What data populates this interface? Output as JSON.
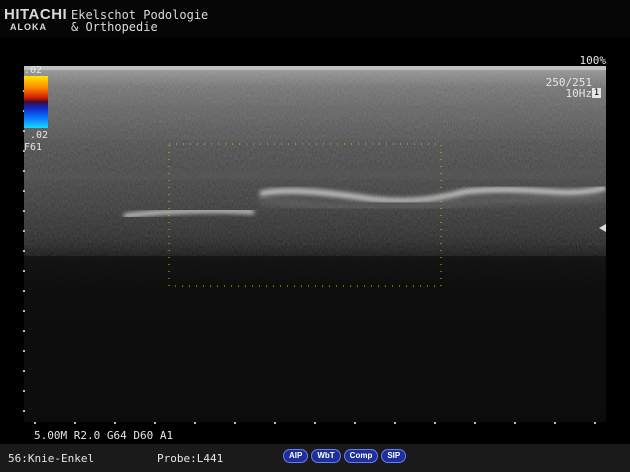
{
  "header": {
    "logo_top": "HITACHI",
    "logo_bottom": "ALOKA",
    "clinic_line1": "Ekelschot Podologie",
    "clinic_line2": "& Orthopedie"
  },
  "readouts": {
    "power": "100%",
    "frame": "250/251",
    "frequency": "10Hz",
    "frequency_box": "1"
  },
  "colorbar": {
    "top_label": ".02",
    "bottom_label": ".02",
    "filter_label": "F61"
  },
  "scan_params": "5.00M R2.0 G64 D60 A1",
  "footer": {
    "preset": "56:Knie-Enkel",
    "probe": "Probe:L441",
    "badges": [
      "AIP",
      "WbT",
      "Comp",
      "SIP"
    ]
  },
  "colors": {
    "roi_dots": "#c8c800",
    "badge_fill": "#1d2f9a",
    "badge_border": "#6a7cf0"
  },
  "icons": {
    "focus_marker": "triangle-left-icon"
  }
}
